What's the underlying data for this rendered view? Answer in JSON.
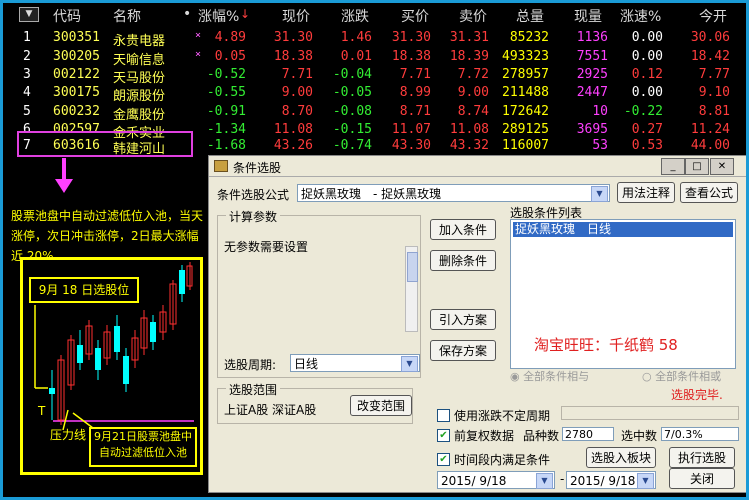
{
  "table": {
    "sort_indicator": "▼",
    "headers": {
      "code": "代码",
      "name": "名称",
      "dot": "•",
      "change_pct": "涨幅%",
      "price": "现价",
      "change": "涨跌",
      "bid": "买价",
      "ask": "卖价",
      "volume": "总量",
      "cur_vol": "现量",
      "speed": "涨速%",
      "open": "今开"
    },
    "rows": [
      {
        "no": "1",
        "code": "300351",
        "name": "永贵电器",
        "mark": "×",
        "change_pct": "4.89",
        "price": "31.30",
        "change": "1.46",
        "bid": "31.30",
        "ask": "31.31",
        "volume": "85232",
        "cur_vol": "1136",
        "speed": "0.00",
        "open": "30.06"
      },
      {
        "no": "2",
        "code": "300205",
        "name": "天喻信息",
        "mark": "×",
        "change_pct": "0.05",
        "price": "18.38",
        "change": "0.01",
        "bid": "18.38",
        "ask": "18.39",
        "volume": "493323",
        "cur_vol": "7551",
        "speed": "0.00",
        "open": "18.42"
      },
      {
        "no": "3",
        "code": "002122",
        "name": "天马股份",
        "mark": "",
        "change_pct": "-0.52",
        "price": "7.71",
        "change": "-0.04",
        "bid": "7.71",
        "ask": "7.72",
        "volume": "278957",
        "cur_vol": "2925",
        "speed": "0.12",
        "open": "7.77"
      },
      {
        "no": "4",
        "code": "300175",
        "name": "朗源股份",
        "mark": "",
        "change_pct": "-0.55",
        "price": "9.00",
        "change": "-0.05",
        "bid": "8.99",
        "ask": "9.00",
        "volume": "211488",
        "cur_vol": "2447",
        "speed": "0.00",
        "open": "9.10"
      },
      {
        "no": "5",
        "code": "600232",
        "name": "金鹰股份",
        "mark": "",
        "change_pct": "-0.91",
        "price": "8.70",
        "change": "-0.08",
        "bid": "8.71",
        "ask": "8.74",
        "volume": "172642",
        "cur_vol": "10",
        "speed": "-0.22",
        "open": "8.81"
      },
      {
        "no": "6",
        "code": "002597",
        "name": "金禾实业",
        "mark": "",
        "change_pct": "-1.34",
        "price": "11.08",
        "change": "-0.15",
        "bid": "11.07",
        "ask": "11.08",
        "volume": "289125",
        "cur_vol": "3695",
        "speed": "0.27",
        "open": "11.24"
      },
      {
        "no": "7",
        "code": "603616",
        "name": "韩建河山",
        "mark": "",
        "change_pct": "-1.68",
        "price": "43.26",
        "change": "-0.74",
        "bid": "43.30",
        "ask": "43.32",
        "volume": "116007",
        "cur_vol": "53",
        "speed": "0.53",
        "open": "44.00"
      }
    ]
  },
  "annotation": {
    "text": "股票池盘中自动过滤低位入池，当天涨停，次日冲击涨停，2日最大涨幅近 20%",
    "chart_label_top": "9月 18 日选股位",
    "chart_label_t": "T",
    "chart_label_pressure": "压力线",
    "chart_label_bottom": "9月21日股票池盘中自动过滤低位入池"
  },
  "dialog": {
    "title": "条件选股",
    "formula_label": "条件选股公式",
    "formula_value": "捉妖黑玫瑰　- 捉妖黑玫瑰",
    "btn_usage": "用法注释",
    "btn_view": "查看公式",
    "params_title": "计算参数",
    "params_text": "无参数需要设置",
    "period_label": "选股周期:",
    "period_value": "日线",
    "btn_add": "加入条件",
    "btn_delete": "删除条件",
    "btn_import": "引入方案",
    "btn_save": "保存方案",
    "list_title": "选股条件列表",
    "list_item": "捉妖黑玫瑰　日线",
    "watermark": "淘宝旺旺：千纸鹤 58",
    "radio_and": "全部条件相与",
    "radio_or": "全部条件相或",
    "status": "选股完毕.",
    "range_title": "选股范围",
    "range_value": "上证A股 深证A股",
    "btn_change_range": "改变范围",
    "chk_limit": "使用涨跌不定周期",
    "chk_rights": "前复权数据",
    "count_label": "品种数",
    "count_value": "2780",
    "selected_label": "选中数",
    "selected_value": "7/0.3%",
    "chk_period": "时间段内满足条件",
    "date_from": "2015/ 9/18",
    "date_to": "2015/ 9/18",
    "btn_to_block": "选股入板块",
    "btn_execute": "执行选股",
    "btn_close": "关闭"
  }
}
